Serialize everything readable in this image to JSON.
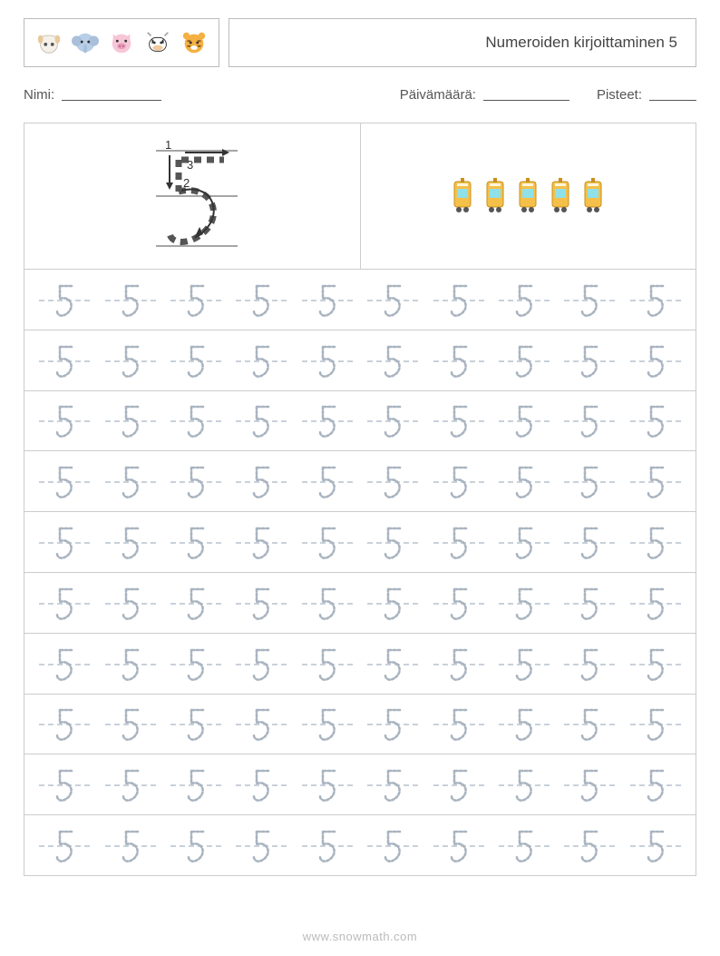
{
  "header": {
    "title": "Numeroiden kirjoittaminen 5",
    "animals": [
      "sheep-icon",
      "elephant-icon",
      "pig-icon",
      "cow-icon",
      "tiger-icon"
    ]
  },
  "meta": {
    "name_label": "Nimi:",
    "name_blank_width": 110,
    "date_label": "Päivämäärä:",
    "date_blank_width": 95,
    "score_label": "Pisteet:",
    "score_blank_width": 52
  },
  "guide": {
    "digit": "5",
    "stroke_labels": [
      "1",
      "2",
      "3"
    ],
    "tram_count": 5
  },
  "practice": {
    "rows": 10,
    "cols": 10,
    "char": "5"
  },
  "footer": {
    "text": "www.snowmath.com"
  }
}
